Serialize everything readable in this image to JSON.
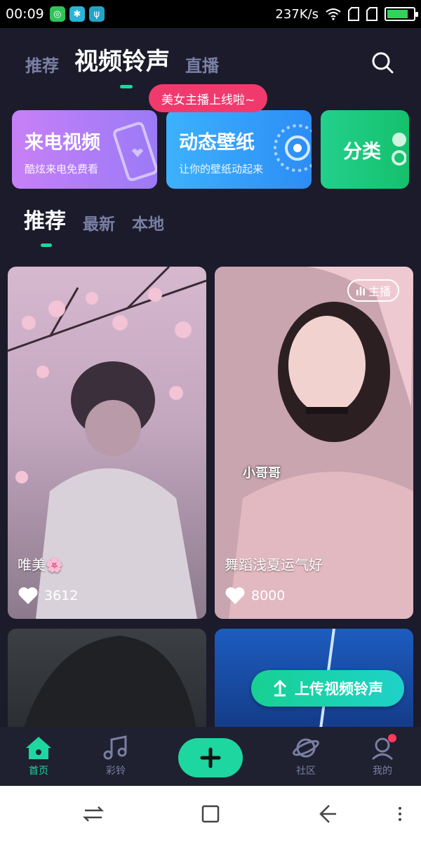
{
  "status_bar": {
    "time": "00:09",
    "network_speed": "237K/s"
  },
  "top_tabs": [
    {
      "label": "推荐",
      "active": false
    },
    {
      "label": "视频铃声",
      "active": true
    },
    {
      "label": "直播",
      "active": false
    }
  ],
  "toast": "美女主播上线啦~",
  "banners": [
    {
      "title": "来电视频",
      "subtitle": "酷炫来电免费看"
    },
    {
      "title": "动态壁纸",
      "subtitle": "让你的壁纸动起来"
    },
    {
      "title": "分类",
      "subtitle": ""
    }
  ],
  "sub_tabs": [
    {
      "label": "推荐",
      "active": true
    },
    {
      "label": "最新",
      "active": false
    },
    {
      "label": "本地",
      "active": false
    }
  ],
  "cards": [
    {
      "title": "唯美🌸",
      "likes": "3612"
    },
    {
      "title": "舞蹈浅夏运气好",
      "likes": "8000",
      "badge": "主播",
      "overlay": "小哥哥"
    }
  ],
  "upload_button": "上传视频铃声",
  "bottom_nav": [
    {
      "label": "首页",
      "active": true
    },
    {
      "label": "彩铃",
      "active": false
    },
    {
      "label": "社区",
      "active": false
    },
    {
      "label": "我的",
      "active": false
    }
  ],
  "colors": {
    "accent": "#1ed6a0",
    "background": "#1b1b2b",
    "toast": "#f03a6e"
  }
}
